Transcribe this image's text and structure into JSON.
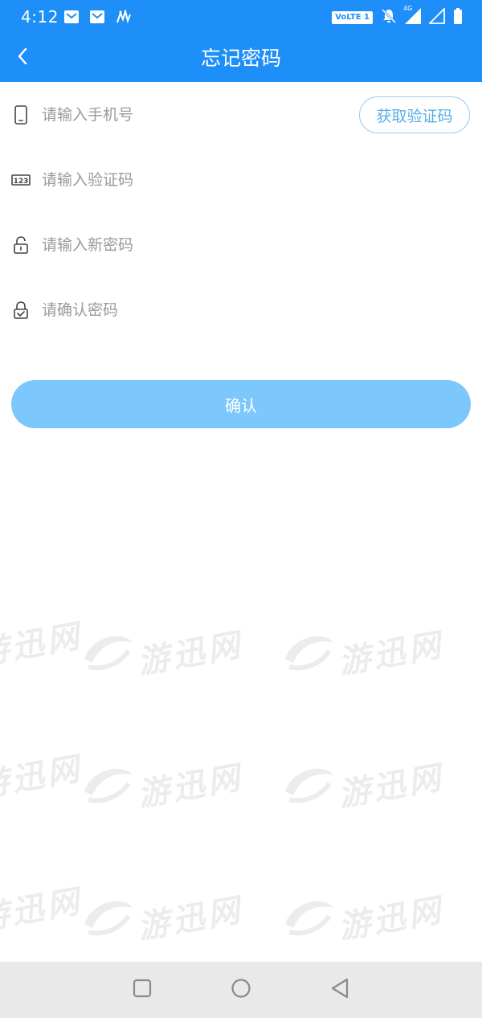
{
  "status_bar": {
    "time": "4:12",
    "volte_label": "VoLTE 1",
    "network_label": "4G",
    "icons": [
      "mail-icon",
      "mail-icon",
      "app-notification-icon",
      "volte-badge",
      "bell-muted-icon",
      "signal-4g-icon",
      "signal-icon",
      "battery-icon"
    ]
  },
  "app_bar": {
    "title": "忘记密码",
    "back_icon": "chevron-left-icon"
  },
  "form": {
    "phone": {
      "placeholder": "请输入手机号",
      "value": "",
      "icon": "phone-icon"
    },
    "get_code_label": "获取验证码",
    "code": {
      "placeholder": "请输入验证码",
      "value": "",
      "icon": "numeric-123-icon"
    },
    "new_password": {
      "placeholder": "请输入新密码",
      "value": "",
      "icon": "lock-icon"
    },
    "confirm_password": {
      "placeholder": "请确认密码",
      "value": "",
      "icon": "lock-check-icon"
    },
    "confirm_label": "确认"
  },
  "watermark": {
    "text": "游迅网"
  },
  "nav_bar": {
    "icons": [
      "square-recents-icon",
      "circle-home-icon",
      "triangle-back-icon"
    ]
  },
  "colors": {
    "primary": "#1e8ff8",
    "confirm_button": "#7cc7fc",
    "code_button_border": "#9cccef",
    "code_button_text": "#56aee9",
    "placeholder": "#9a9a9a",
    "nav_bar": "#e9e9e9"
  }
}
